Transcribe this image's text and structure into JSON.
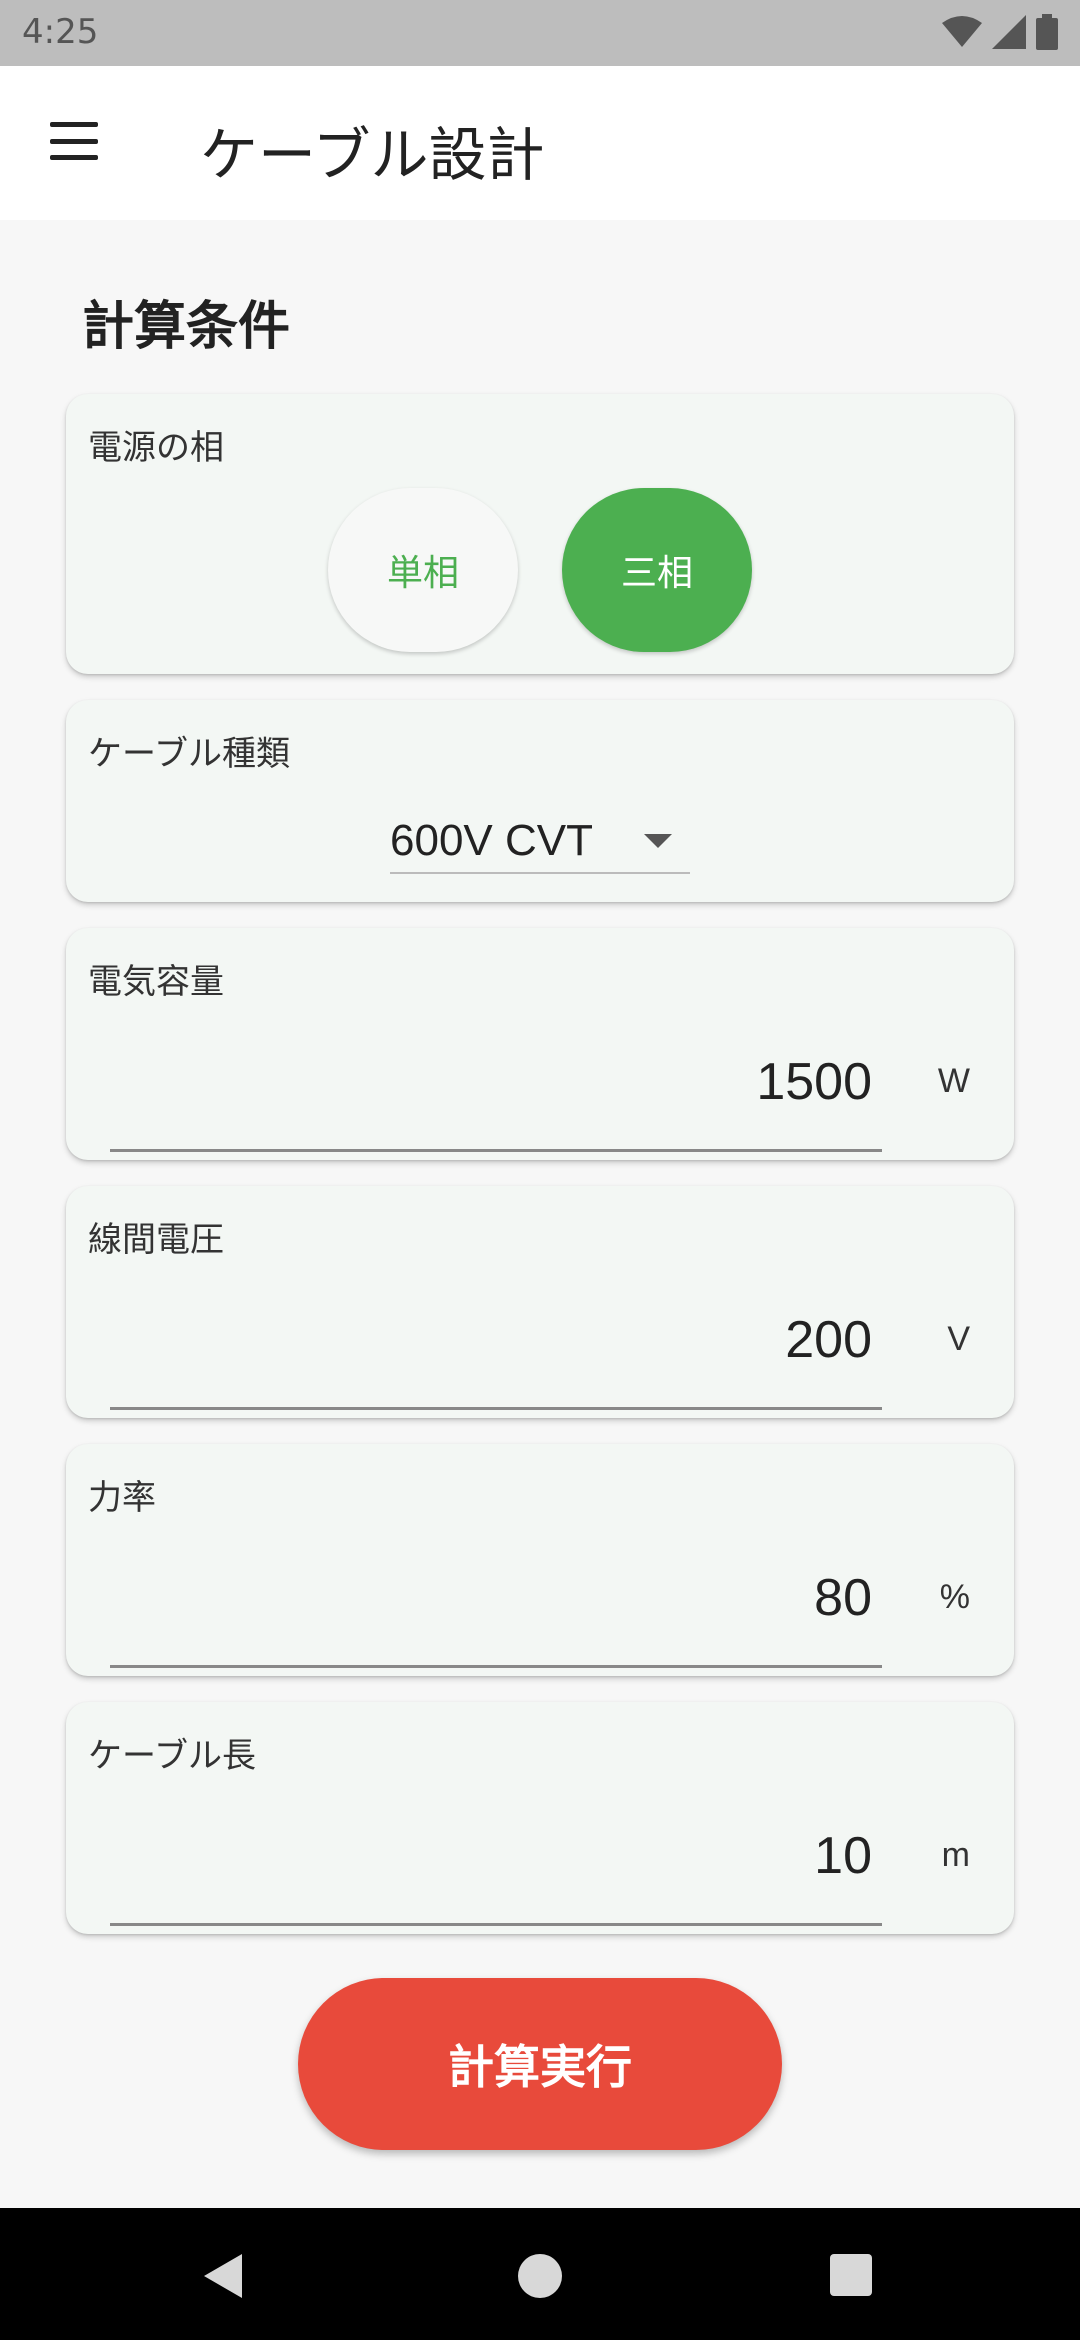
{
  "status_bar": {
    "time": "4:25"
  },
  "app_bar": {
    "title": "ケーブル設計"
  },
  "section": {
    "title": "計算条件"
  },
  "phase": {
    "label": "電源の相",
    "options": [
      "単相",
      "三相"
    ],
    "selected": "三相"
  },
  "cable_type": {
    "label": "ケーブル種類",
    "value": "600V CVT"
  },
  "capacity": {
    "label": "電気容量",
    "value": "1500",
    "unit": "W"
  },
  "voltage": {
    "label": "線間電圧",
    "value": "200",
    "unit": "V"
  },
  "power_factor": {
    "label": "力率",
    "value": "80",
    "unit": "%"
  },
  "cable_length": {
    "label": "ケーブル長",
    "value": "10",
    "unit": "m"
  },
  "action": {
    "calculate_label": "計算実行"
  },
  "colors": {
    "accent_green": "#4caf50",
    "action_red": "#e84a3b"
  }
}
